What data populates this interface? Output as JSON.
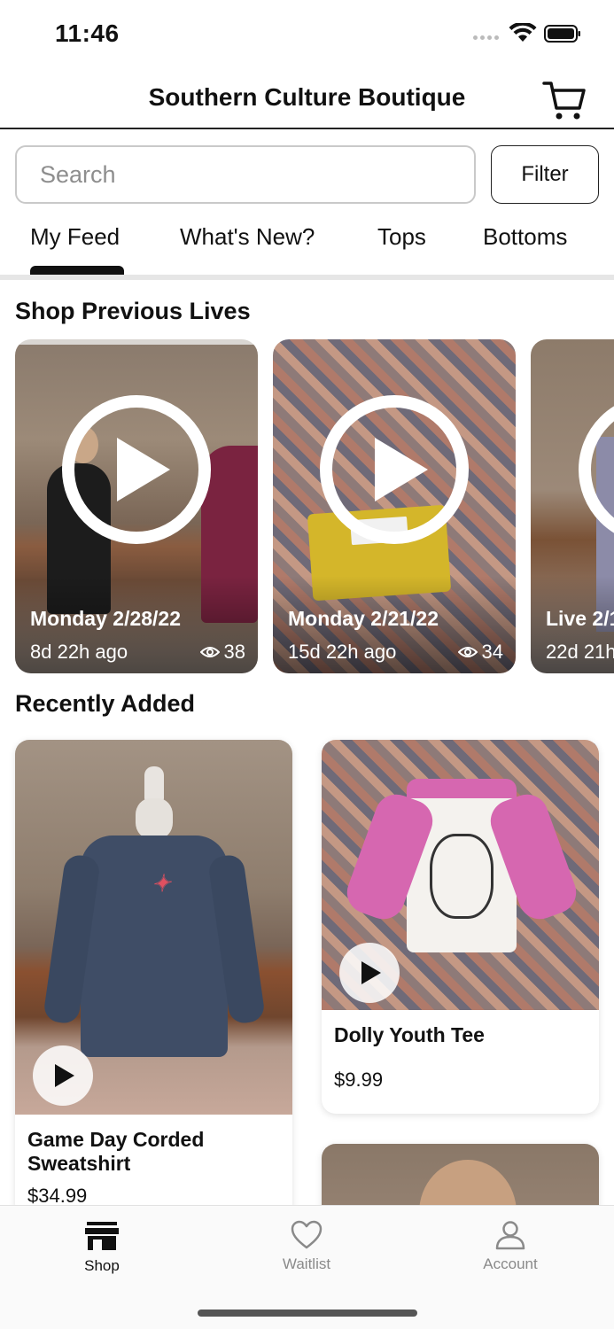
{
  "status_bar": {
    "time": "11:46"
  },
  "header": {
    "title": "Southern Culture Boutique",
    "cart_icon": "cart-icon"
  },
  "search": {
    "placeholder": "Search",
    "filter_label": "Filter"
  },
  "tabs": [
    {
      "label": "My Feed",
      "active": true
    },
    {
      "label": "What's New?"
    },
    {
      "label": "Tops"
    },
    {
      "label": "Bottoms"
    }
  ],
  "lives_section": {
    "title": "Shop Previous Lives",
    "items": [
      {
        "date": "Monday 2/28/22",
        "ago": "8d 22h ago",
        "views": "38"
      },
      {
        "date": "Monday 2/21/22",
        "ago": "15d 22h ago",
        "views": "34"
      },
      {
        "date": "Live 2/1",
        "ago": "22d 21h"
      }
    ]
  },
  "recent_section": {
    "title": "Recently Added",
    "products": [
      {
        "name": "Game Day Corded Sweatshirt",
        "price": "$34.99"
      },
      {
        "name": "Dolly Youth Tee",
        "price": "$9.99"
      }
    ]
  },
  "bottom_nav": {
    "items": [
      {
        "label": "Shop",
        "icon": "store-icon",
        "active": true
      },
      {
        "label": "Waitlist",
        "icon": "heart-icon"
      },
      {
        "label": "Account",
        "icon": "person-icon"
      }
    ]
  },
  "colors": {
    "accent": "#111111",
    "tab_divider": "#e6e6e6",
    "inactive_nav": "#8a8a8a"
  }
}
